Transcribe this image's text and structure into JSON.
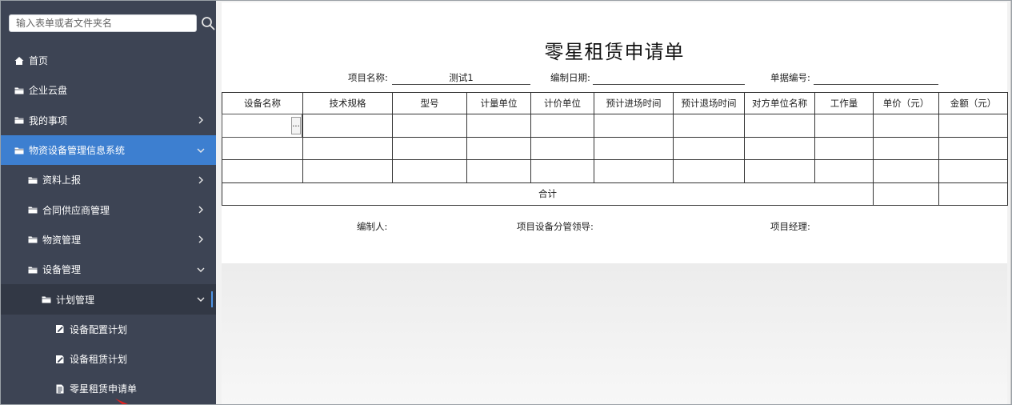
{
  "sidebar": {
    "search_placeholder": "输入表单或者文件夹名",
    "search_value": "",
    "items": [
      {
        "label": "首页",
        "icon": "home-icon",
        "level": 0,
        "state": "normal",
        "chevron": "none"
      },
      {
        "label": "企业云盘",
        "icon": "folder-icon",
        "level": 0,
        "state": "normal",
        "chevron": "none"
      },
      {
        "label": "我的事项",
        "icon": "folder-icon",
        "level": 0,
        "state": "normal",
        "chevron": "right"
      },
      {
        "label": "物资设备管理信息系统",
        "icon": "folder-icon",
        "level": 0,
        "state": "active",
        "chevron": "down"
      },
      {
        "label": "资料上报",
        "icon": "folder-icon",
        "level": 1,
        "state": "normal",
        "chevron": "right"
      },
      {
        "label": "合同供应商管理",
        "icon": "folder-icon",
        "level": 1,
        "state": "normal",
        "chevron": "right"
      },
      {
        "label": "物资管理",
        "icon": "folder-icon",
        "level": 1,
        "state": "normal",
        "chevron": "right"
      },
      {
        "label": "设备管理",
        "icon": "folder-icon",
        "level": 1,
        "state": "normal",
        "chevron": "down"
      },
      {
        "label": "计划管理",
        "icon": "folder-icon",
        "level": 2,
        "state": "sub-active",
        "chevron": "down"
      },
      {
        "label": "设备配置计划",
        "icon": "edit-doc-icon",
        "level": 3,
        "state": "normal",
        "chevron": "none"
      },
      {
        "label": "设备租赁计划",
        "icon": "edit-doc-icon",
        "level": 3,
        "state": "normal",
        "chevron": "none"
      },
      {
        "label": "零星租赁申请单",
        "icon": "doc-icon",
        "level": 3,
        "state": "normal",
        "chevron": "none"
      }
    ]
  },
  "form": {
    "title": "零星租赁申请单",
    "project_name_label": "项目名称:",
    "project_name_value": "测试1",
    "date_label": "编制日期:",
    "date_value": "",
    "doc_no_label": "单据编号:",
    "doc_no_value": "",
    "columns": [
      "设备名称",
      "技术规格",
      "型号",
      "计量单位",
      "计价单位",
      "预计进场时间",
      "预计退场时间",
      "对方单位名称",
      "工作量",
      "单价（元）",
      "金额（元）"
    ],
    "rows": [
      [
        "",
        "",
        "",
        "",
        "",
        "",
        "",
        "",
        "",
        "",
        ""
      ],
      [
        "",
        "",
        "",
        "",
        "",
        "",
        "",
        "",
        "",
        "",
        ""
      ],
      [
        "",
        "",
        "",
        "",
        "",
        "",
        "",
        "",
        "",
        "",
        ""
      ]
    ],
    "ellipsis_label": "...",
    "total_label": "合计",
    "total_unit_price": "",
    "total_amount": "",
    "preparer_label": "编制人:",
    "leader_label": "项目设备分管领导:",
    "manager_label": "项目经理:"
  },
  "colors": {
    "sidebar_bg": "#3d4454",
    "active_bg": "#3d7fd0",
    "sub_active_bg": "#323845",
    "accent_bar": "#4f94e6",
    "cursor_arrow": "#e02020"
  }
}
